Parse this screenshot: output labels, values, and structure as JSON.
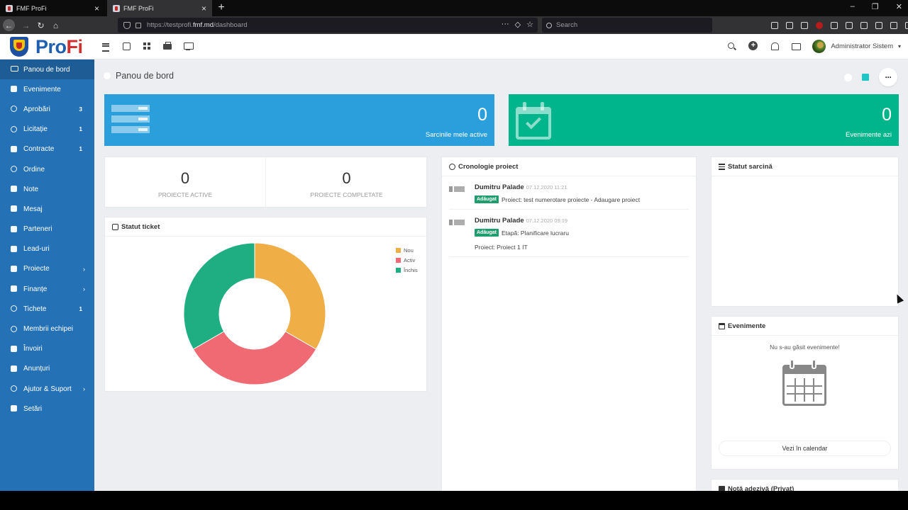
{
  "browser": {
    "tabs": [
      {
        "label": "FMF ProFi"
      },
      {
        "label": "FMF ProFi"
      }
    ],
    "url_prefix": "https://testprofi.",
    "url_host": "fmf.md",
    "url_path": "/dashboard",
    "search_placeholder": "Search"
  },
  "header": {
    "brand_p": "Pro",
    "brand_f": "Fi",
    "user_name": "Administrator Sistem"
  },
  "sidebar": {
    "items": [
      {
        "label": "Panou de bord",
        "badge": ""
      },
      {
        "label": "Evenimente",
        "badge": ""
      },
      {
        "label": "Aprobări",
        "badge": "3"
      },
      {
        "label": "Licitație",
        "badge": "1"
      },
      {
        "label": "Contracte",
        "badge": "1"
      },
      {
        "label": "Ordine",
        "badge": ""
      },
      {
        "label": "Note",
        "badge": ""
      },
      {
        "label": "Mesaj",
        "badge": ""
      },
      {
        "label": "Parteneri",
        "badge": ""
      },
      {
        "label": "Lead-uri",
        "badge": ""
      },
      {
        "label": "Proiecte",
        "badge": "›"
      },
      {
        "label": "Finanțe",
        "badge": "›"
      },
      {
        "label": "Tichete",
        "badge": "1"
      },
      {
        "label": "Membrii echipei",
        "badge": ""
      },
      {
        "label": "Învoiri",
        "badge": ""
      },
      {
        "label": "Anunțuri",
        "badge": ""
      },
      {
        "label": "Ajutor & Suport",
        "badge": "›"
      },
      {
        "label": "Setări",
        "badge": ""
      }
    ]
  },
  "page": {
    "title": "Panou de bord"
  },
  "stats": {
    "tasks_value": "0",
    "tasks_label": "Sarcinile mele active",
    "events_value": "0",
    "events_label": "Evenimente azi"
  },
  "projects": {
    "active_value": "0",
    "active_label": "PROIECTE ACTIVE",
    "completed_value": "0",
    "completed_label": "PROIECTE COMPLETATE"
  },
  "ticket_status": {
    "title": "Statut ticket"
  },
  "chart_data": {
    "type": "pie",
    "title": "Statut ticket",
    "categories": [
      "Nou",
      "Activ",
      "Închis"
    ],
    "values": [
      1,
      1,
      1
    ],
    "colors": [
      "#efae46",
      "#ef6a72",
      "#1fae82"
    ],
    "legend_position": "top-right"
  },
  "timeline": {
    "title": "Cronologie proiect",
    "entries": [
      {
        "author": "Dumitru Palade",
        "date": "07.12.2020 11:21",
        "badge": "Adăugat",
        "text": "Proiect: test numerotare proiecte - Adaugare proiect",
        "sub": ""
      },
      {
        "author": "Dumitru Palade",
        "date": "07.12.2020 09:19",
        "badge": "Adăugat",
        "text": "Etapă: Planificare lucraru",
        "sub": "Proiect: Proiect 1 IT"
      }
    ]
  },
  "task_status": {
    "title": "Statut sarcină"
  },
  "events": {
    "title": "Evenimente",
    "empty_text": "Nu s-au găsit evenimente!",
    "button_label": "Vezi în calendar"
  },
  "sticky_note": {
    "title": "Notă adezivă (Privat)"
  }
}
